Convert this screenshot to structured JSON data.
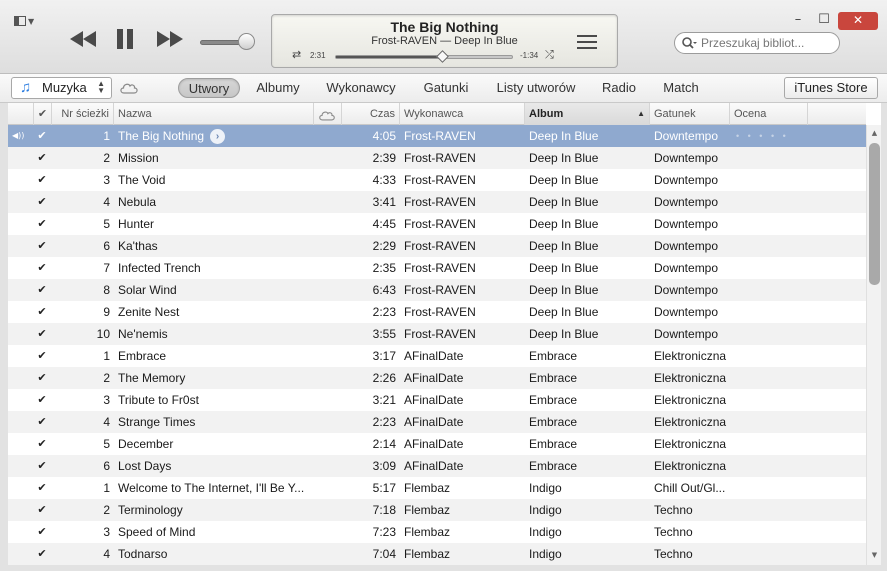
{
  "window": {
    "minimize_label": "–",
    "maximize_label": "☐",
    "close_label": "✕"
  },
  "player": {
    "now_playing_title": "The Big Nothing",
    "now_playing_subtitle": "Frost-RAVEN — Deep In Blue",
    "elapsed": "2:31",
    "remaining": "-1:34",
    "progress_fraction": 0.61,
    "volume_fraction": 0.85,
    "icons": [
      "rewind-icon",
      "pause-icon",
      "fast-forward-icon",
      "repeat-icon",
      "shuffle-icon",
      "up-next-list-icon"
    ]
  },
  "search": {
    "placeholder": "Przeszukaj bibliot..."
  },
  "nav": {
    "library_label": "Muzyka",
    "tabs": [
      {
        "label": "Utwory",
        "active": true
      },
      {
        "label": "Albumy",
        "active": false
      },
      {
        "label": "Wykonawcy",
        "active": false
      },
      {
        "label": "Gatunki",
        "active": false
      },
      {
        "label": "Listy utworów",
        "active": false
      },
      {
        "label": "Radio",
        "active": false
      },
      {
        "label": "Match",
        "active": false
      }
    ],
    "store_label": "iTunes Store"
  },
  "columns": {
    "check": "✔",
    "track_number": "Nr ścieżki",
    "name": "Nazwa",
    "time": "Czas",
    "artist": "Wykonawca",
    "album": "Album",
    "genre": "Gatunek",
    "rating": "Ocena",
    "sorted_by": "album",
    "sort_direction": "ascending"
  },
  "tracks": [
    {
      "num": "1",
      "name": "The Big Nothing",
      "time": "4:05",
      "artist": "Frost-RAVEN",
      "album": "Deep In Blue",
      "genre": "Downtempo",
      "playing": true,
      "rating": "• • • • •"
    },
    {
      "num": "2",
      "name": "Mission",
      "time": "2:39",
      "artist": "Frost-RAVEN",
      "album": "Deep In Blue",
      "genre": "Downtempo"
    },
    {
      "num": "3",
      "name": "The Void",
      "time": "4:33",
      "artist": "Frost-RAVEN",
      "album": "Deep In Blue",
      "genre": "Downtempo"
    },
    {
      "num": "4",
      "name": "Nebula",
      "time": "3:41",
      "artist": "Frost-RAVEN",
      "album": "Deep In Blue",
      "genre": "Downtempo"
    },
    {
      "num": "5",
      "name": "Hunter",
      "time": "4:45",
      "artist": "Frost-RAVEN",
      "album": "Deep In Blue",
      "genre": "Downtempo"
    },
    {
      "num": "6",
      "name": "Ka'thas",
      "time": "2:29",
      "artist": "Frost-RAVEN",
      "album": "Deep In Blue",
      "genre": "Downtempo"
    },
    {
      "num": "7",
      "name": "Infected Trench",
      "time": "2:35",
      "artist": "Frost-RAVEN",
      "album": "Deep In Blue",
      "genre": "Downtempo"
    },
    {
      "num": "8",
      "name": "Solar Wind",
      "time": "6:43",
      "artist": "Frost-RAVEN",
      "album": "Deep In Blue",
      "genre": "Downtempo"
    },
    {
      "num": "9",
      "name": "Zenite Nest",
      "time": "2:23",
      "artist": "Frost-RAVEN",
      "album": "Deep In Blue",
      "genre": "Downtempo"
    },
    {
      "num": "10",
      "name": "Ne'nemis",
      "time": "3:55",
      "artist": "Frost-RAVEN",
      "album": "Deep In Blue",
      "genre": "Downtempo"
    },
    {
      "num": "1",
      "name": "Embrace",
      "time": "3:17",
      "artist": "AFinalDate",
      "album": "Embrace",
      "genre": "Elektroniczna"
    },
    {
      "num": "2",
      "name": "The Memory",
      "time": "2:26",
      "artist": "AFinalDate",
      "album": "Embrace",
      "genre": "Elektroniczna"
    },
    {
      "num": "3",
      "name": "Tribute to Fr0st",
      "time": "3:21",
      "artist": "AFinalDate",
      "album": "Embrace",
      "genre": "Elektroniczna"
    },
    {
      "num": "4",
      "name": "Strange Times",
      "time": "2:23",
      "artist": "AFinalDate",
      "album": "Embrace",
      "genre": "Elektroniczna"
    },
    {
      "num": "5",
      "name": "December",
      "time": "2:14",
      "artist": "AFinalDate",
      "album": "Embrace",
      "genre": "Elektroniczna"
    },
    {
      "num": "6",
      "name": "Lost Days",
      "time": "3:09",
      "artist": "AFinalDate",
      "album": "Embrace",
      "genre": "Elektroniczna"
    },
    {
      "num": "1",
      "name": "Welcome to The Internet, I'll Be Y...",
      "time": "5:17",
      "artist": "Flembaz",
      "album": "Indigo",
      "genre": "Chill Out/Gl..."
    },
    {
      "num": "2",
      "name": "Terminology",
      "time": "7:18",
      "artist": "Flembaz",
      "album": "Indigo",
      "genre": "Techno"
    },
    {
      "num": "3",
      "name": "Speed of Mind",
      "time": "7:23",
      "artist": "Flembaz",
      "album": "Indigo",
      "genre": "Techno"
    },
    {
      "num": "4",
      "name": "Todnarso",
      "time": "7:04",
      "artist": "Flembaz",
      "album": "Indigo",
      "genre": "Techno"
    }
  ],
  "colors": {
    "selection": "#8fa9cf",
    "accent": "#2a7ce0",
    "close_button": "#c9463d"
  }
}
